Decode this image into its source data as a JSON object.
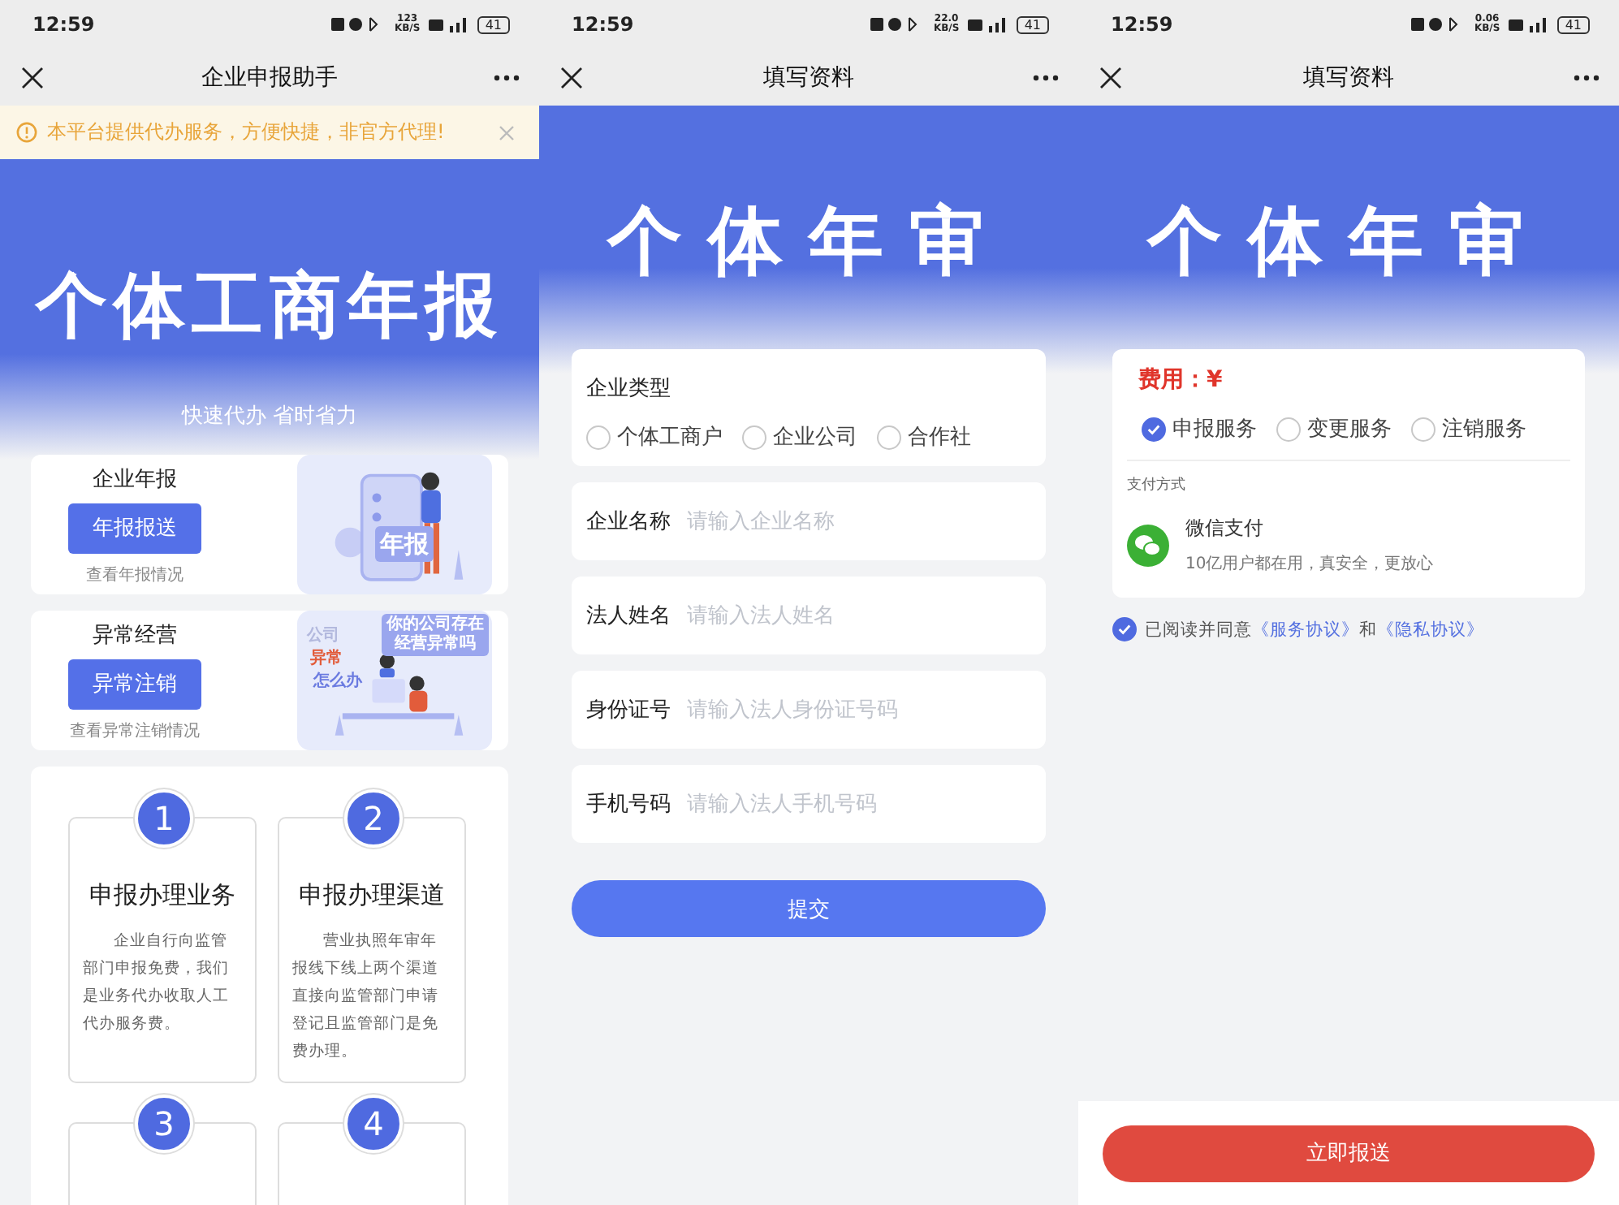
{
  "screens": [
    {
      "kind": "home",
      "status_bar": {
        "time": "12:59",
        "speed": "123 KB/S",
        "battery": "41"
      },
      "title": "企业申报助手",
      "notice": "本平台提供代办服务，方便快捷，非官方代理!",
      "hero": {
        "title": "个体工商年报",
        "subtitle": "快速代办 省时省力"
      },
      "services": [
        {
          "heading": "企业年报",
          "button": "年报报送",
          "link": "查看年报情况",
          "illustration": {
            "kind": "phone",
            "labels": [
              "年报"
            ]
          }
        },
        {
          "heading": "异常经营",
          "button": "异常注销",
          "link": "查看异常注销情况",
          "illustration": {
            "kind": "desk",
            "labels": [
              "公司",
              "异常",
              "怎么办",
              "你的公司存在经营异常吗"
            ]
          }
        }
      ],
      "steps": [
        {
          "number": "1",
          "title": "申报办理业务",
          "text": "企业自行向监管部门申报免费，我们是业务代办收取人工代办服务费。"
        },
        {
          "number": "2",
          "title": "申报办理渠道",
          "text": "营业执照年审年报线下线上两个渠道直接向监管部门申请登记且监管部门是免费办理。"
        },
        {
          "number": "3"
        },
        {
          "number": "4"
        }
      ]
    },
    {
      "kind": "form",
      "status_bar": {
        "time": "12:59",
        "speed": "22.0 KB/S",
        "battery": "41"
      },
      "title": "填写资料",
      "hero": {
        "title": "个体年审"
      },
      "type_field": {
        "label": "企业类型",
        "options": [
          {
            "label": "个体工商户",
            "selected": false
          },
          {
            "label": "企业公司",
            "selected": false
          },
          {
            "label": "合作社",
            "selected": false
          }
        ]
      },
      "fields": [
        {
          "label": "企业名称",
          "placeholder": "请输入企业名称"
        },
        {
          "label": "法人姓名",
          "placeholder": "请输入法人姓名"
        },
        {
          "label": "身份证号",
          "placeholder": "请输入法人身份证号码"
        },
        {
          "label": "手机号码",
          "placeholder": "请输入法人手机号码"
        }
      ],
      "submit": "提交"
    },
    {
      "kind": "payment",
      "status_bar": {
        "time": "12:59",
        "speed": "0.06 KB/S",
        "battery": "41"
      },
      "title": "填写资料",
      "hero": {
        "title": "个体年审"
      },
      "fee_label": "费用：¥",
      "services": [
        {
          "label": "申报服务",
          "selected": true
        },
        {
          "label": "变更服务",
          "selected": false
        },
        {
          "label": "注销服务",
          "selected": false
        }
      ],
      "payment_heading": "支付方式",
      "payment_method": {
        "name": "微信支付",
        "description": "10亿用户都在用，真安全，更放心"
      },
      "agreement": {
        "checked": true,
        "text": "已阅读并同意",
        "links": [
          "《服务协议》",
          "《隐私协议》"
        ],
        "joiner": "和"
      },
      "action": "立即报送"
    }
  ]
}
